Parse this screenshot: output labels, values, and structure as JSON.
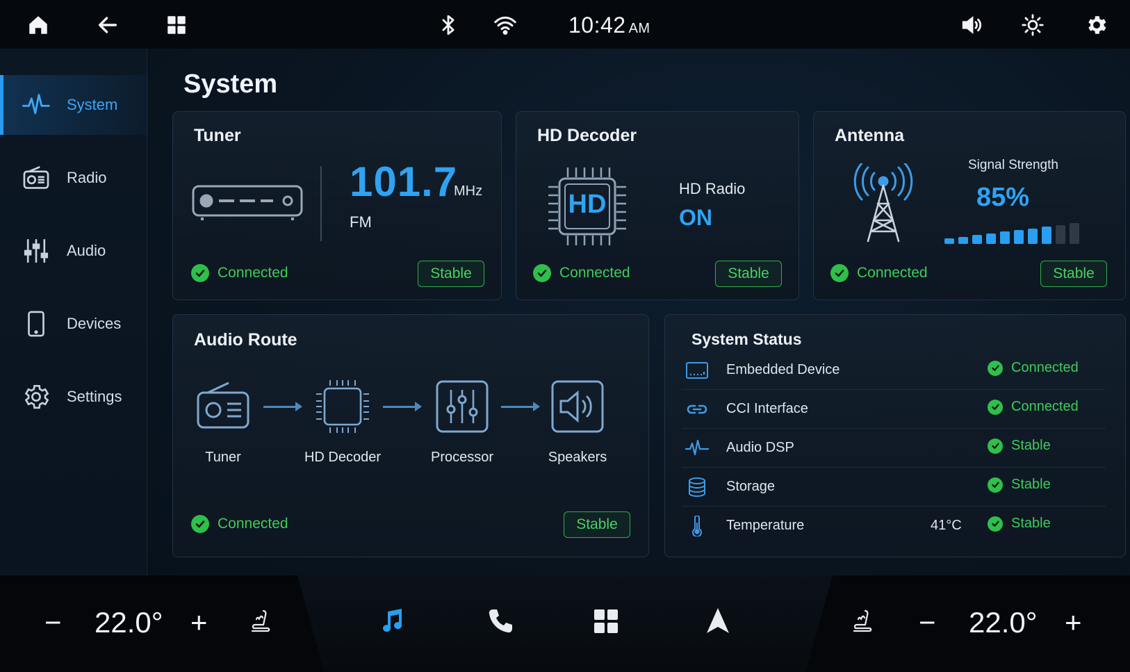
{
  "status_bar": {
    "time": "10:42",
    "ampm": "AM",
    "icons": [
      "home-icon",
      "back-icon",
      "apps-grid-icon",
      "bluetooth-icon",
      "wifi-icon",
      "volume-icon",
      "brightness-icon",
      "settings-gear-icon"
    ]
  },
  "sidebar": {
    "items": [
      {
        "label": "System",
        "icon": "waveform-icon",
        "active": true
      },
      {
        "label": "Radio",
        "icon": "radio-icon",
        "active": false
      },
      {
        "label": "Audio",
        "icon": "sliders-icon",
        "active": false
      },
      {
        "label": "Devices",
        "icon": "tablet-icon",
        "active": false
      },
      {
        "label": "Settings",
        "icon": "gear-icon",
        "active": false
      }
    ]
  },
  "page": {
    "title": "System"
  },
  "tuner": {
    "title": "Tuner",
    "frequency": "101.7",
    "unit": "MHz",
    "band": "FM",
    "status": "Connected",
    "badge": "Stable"
  },
  "hd_decoder": {
    "title": "HD Decoder",
    "chip_text": "HD",
    "label": "HD Radio",
    "value": "ON",
    "status": "Connected",
    "badge": "Stable"
  },
  "antenna": {
    "title": "Antenna",
    "signal_label": "Signal Strength",
    "signal_value": "85%",
    "signal_level": 0.8,
    "status": "Connected",
    "badge": "Stable"
  },
  "audio_route": {
    "title": "Audio Route",
    "nodes": [
      {
        "label": "Tuner",
        "icon": "radio-icon"
      },
      {
        "label": "HD Decoder",
        "icon": "chip-icon"
      },
      {
        "label": "Processor",
        "icon": "equalizer-icon"
      },
      {
        "label": "Speakers",
        "icon": "speaker-icon"
      }
    ],
    "status": "Connected",
    "badge": "Stable"
  },
  "system_status": {
    "title": "System Status",
    "rows": [
      {
        "label": "Embedded Device",
        "extra": "",
        "status": "Connected",
        "icon": "embedded-device-icon"
      },
      {
        "label": "CCI Interface",
        "extra": "",
        "status": "Connected",
        "icon": "link-icon"
      },
      {
        "label": "Audio DSP",
        "extra": "",
        "status": "Stable",
        "icon": "waveform-icon"
      },
      {
        "label": "Storage",
        "extra": "",
        "status": "Stable",
        "icon": "database-icon"
      },
      {
        "label": "Temperature",
        "extra": "41°C",
        "status": "Stable",
        "icon": "thermometer-icon"
      }
    ]
  },
  "climate": {
    "left_temp": "22.0°",
    "right_temp": "22.0°",
    "minus": "−",
    "plus": "+"
  },
  "dock": {
    "items": [
      "music-icon",
      "phone-icon",
      "apps-grid-icon",
      "navigation-icon"
    ],
    "active": "music-icon",
    "accent": "#2a9ef0"
  },
  "colors": {
    "accent": "#2fa3f2",
    "ok": "#3fcc5a"
  }
}
